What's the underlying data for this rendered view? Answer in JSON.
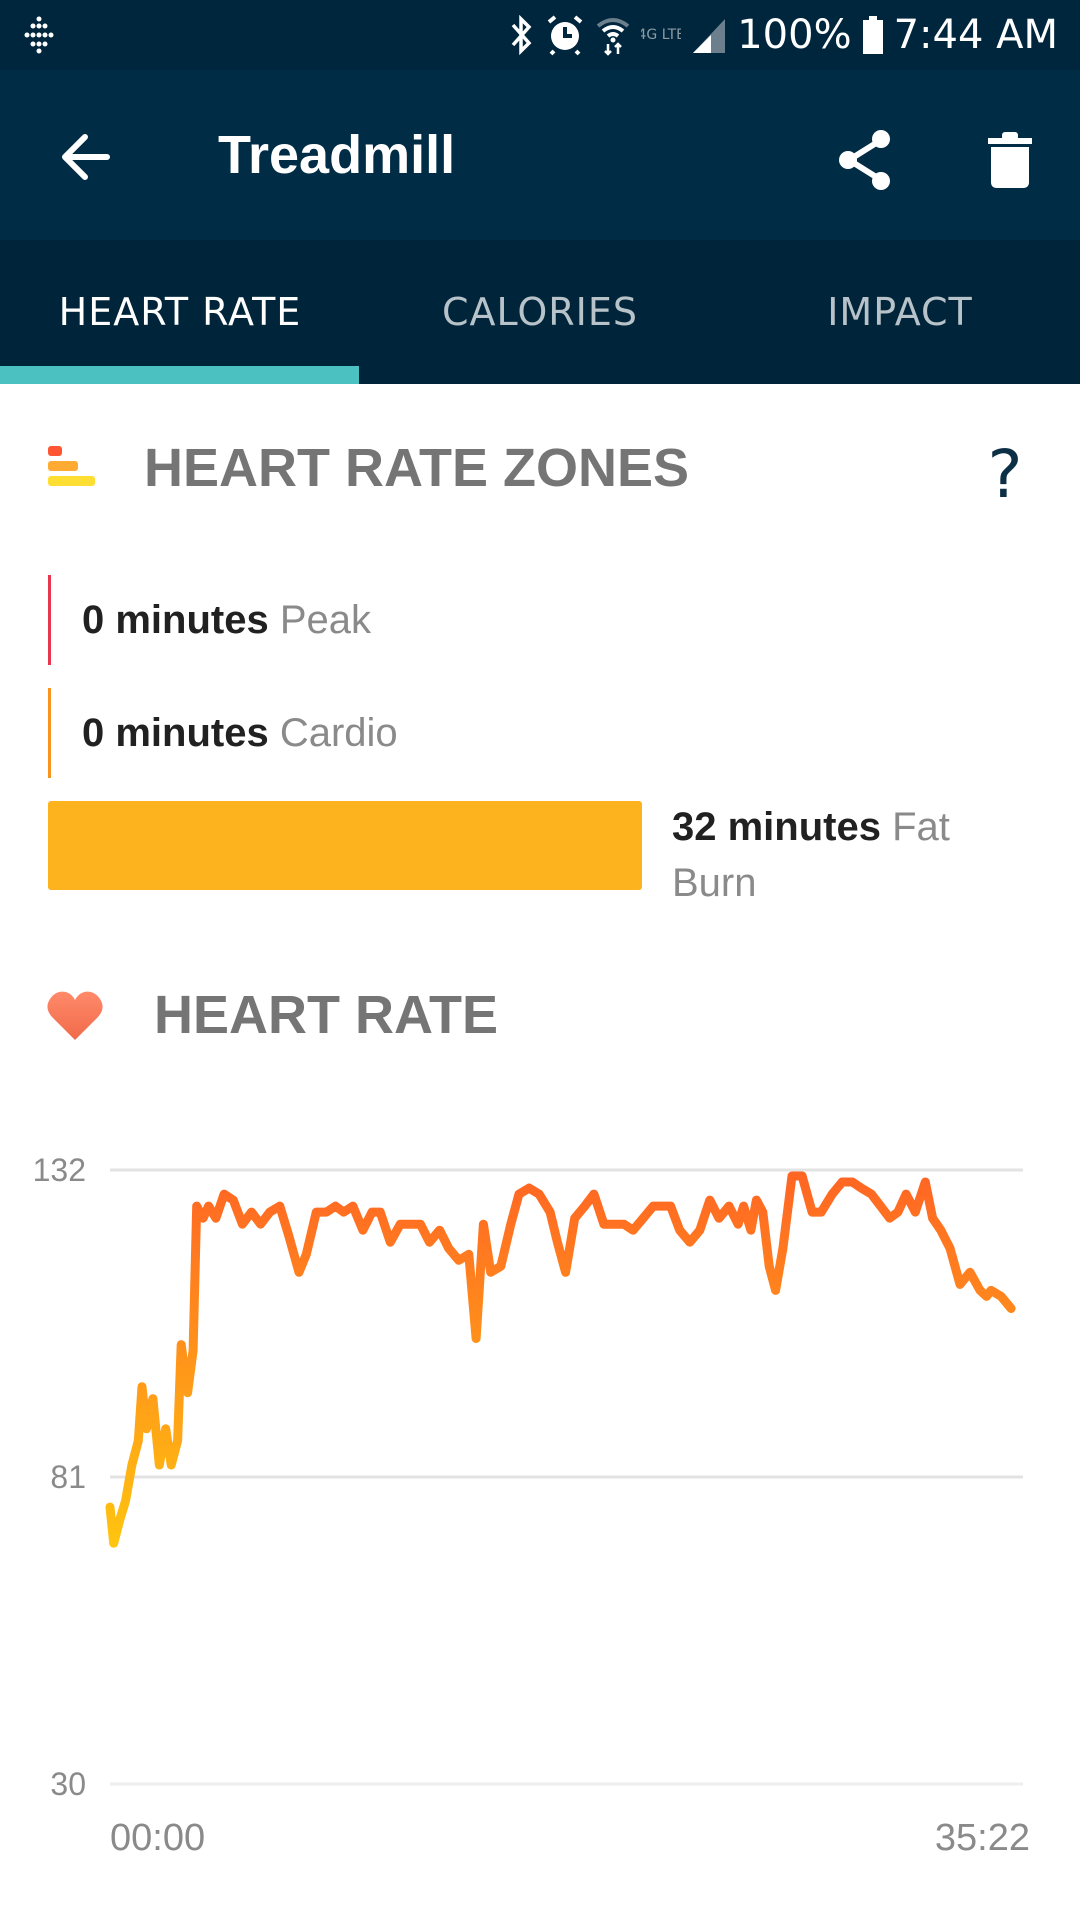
{
  "status_bar": {
    "time": "7:44 AM",
    "battery": "100%",
    "network": "4G LTE",
    "icons": [
      "fitbit-logo-icon",
      "bluetooth-icon",
      "alarm-icon",
      "wifi-icon",
      "4g-lte-icon",
      "signal-icon",
      "battery-icon"
    ]
  },
  "app_bar": {
    "title": "Treadmill",
    "back_icon": "arrow-back-icon",
    "actions": [
      {
        "name": "share",
        "icon": "share-icon"
      },
      {
        "name": "delete",
        "icon": "trash-icon"
      }
    ],
    "colors": {
      "background": "#002c45",
      "tabbar": "#00253a",
      "indicator": "#4cc1c1"
    }
  },
  "tabs": [
    {
      "label": "HEART RATE",
      "active": true
    },
    {
      "label": "CALORIES",
      "active": false
    },
    {
      "label": "IMPACT",
      "active": false
    }
  ],
  "zones_section": {
    "title": "HEART RATE ZONES",
    "help_label": "?",
    "zones": [
      {
        "minutes": "0 minutes",
        "name": "Peak",
        "color": "#e8364f"
      },
      {
        "minutes": "0 minutes",
        "name": "Cardio",
        "color": "#f7941d"
      },
      {
        "minutes": "32 minutes",
        "name_line1": "Fat",
        "name_line2": "Burn",
        "color": "#fdb31d"
      }
    ]
  },
  "heart_rate_section": {
    "title": "HEART RATE"
  },
  "chart_data": {
    "type": "line",
    "title": "HEART RATE",
    "xlabel": "",
    "ylabel": "",
    "y_ticks": [
      132,
      81,
      30
    ],
    "ylim": [
      30,
      132
    ],
    "x_tick_labels": [
      "00:00",
      "35:22"
    ],
    "x_range_seconds": [
      0,
      2122
    ],
    "grid": true,
    "line_colors": {
      "low": "#ffc80f",
      "high": "#ff6424"
    },
    "series": [
      {
        "name": "heart_rate_bpm",
        "x_fraction": [
          0.0,
          0.004,
          0.011,
          0.017,
          0.024,
          0.031,
          0.035,
          0.04,
          0.047,
          0.054,
          0.061,
          0.067,
          0.074,
          0.078,
          0.085,
          0.091,
          0.095,
          0.102,
          0.108,
          0.116,
          0.125,
          0.135,
          0.145,
          0.155,
          0.165,
          0.175,
          0.186,
          0.196,
          0.207,
          0.215,
          0.226,
          0.237,
          0.247,
          0.256,
          0.266,
          0.277,
          0.287,
          0.296,
          0.307,
          0.318,
          0.328,
          0.34,
          0.35,
          0.361,
          0.371,
          0.382,
          0.393,
          0.401,
          0.409,
          0.417,
          0.428,
          0.439,
          0.448,
          0.459,
          0.47,
          0.482,
          0.49,
          0.499,
          0.509,
          0.52,
          0.53,
          0.541,
          0.552,
          0.563,
          0.573,
          0.584,
          0.595,
          0.605,
          0.614,
          0.624,
          0.635,
          0.646,
          0.657,
          0.667,
          0.678,
          0.688,
          0.694,
          0.702,
          0.708,
          0.715,
          0.722,
          0.729,
          0.737,
          0.747,
          0.758,
          0.769,
          0.779,
          0.791,
          0.802,
          0.813,
          0.823,
          0.834,
          0.844,
          0.854,
          0.863,
          0.872,
          0.882,
          0.893,
          0.901,
          0.91,
          0.92,
          0.931,
          0.942,
          0.953,
          0.96,
          0.965,
          0.976,
          0.987
        ],
        "values": [
          76,
          70,
          74,
          77,
          83,
          87,
          96,
          89,
          94,
          83,
          89,
          83,
          87,
          103,
          95,
          102,
          126,
          124,
          126,
          124,
          128,
          127,
          123,
          125,
          123,
          125,
          126,
          121,
          115,
          118,
          125,
          125,
          126,
          125,
          126,
          122,
          125,
          125,
          120,
          123,
          123,
          123,
          120,
          122,
          119,
          117,
          118,
          104,
          123,
          115,
          116,
          123,
          128,
          129,
          128,
          125,
          120,
          115,
          124,
          126,
          128,
          123,
          123,
          123,
          122,
          124,
          126,
          126,
          126,
          122,
          120,
          122,
          127,
          124,
          126,
          123,
          126,
          122,
          127,
          125,
          116,
          112,
          119,
          131,
          131,
          125,
          125,
          128,
          130,
          130,
          129,
          128,
          126,
          124,
          125,
          128,
          125,
          130,
          124,
          122,
          119,
          113,
          115,
          112,
          111,
          112,
          111,
          109
        ]
      }
    ]
  }
}
